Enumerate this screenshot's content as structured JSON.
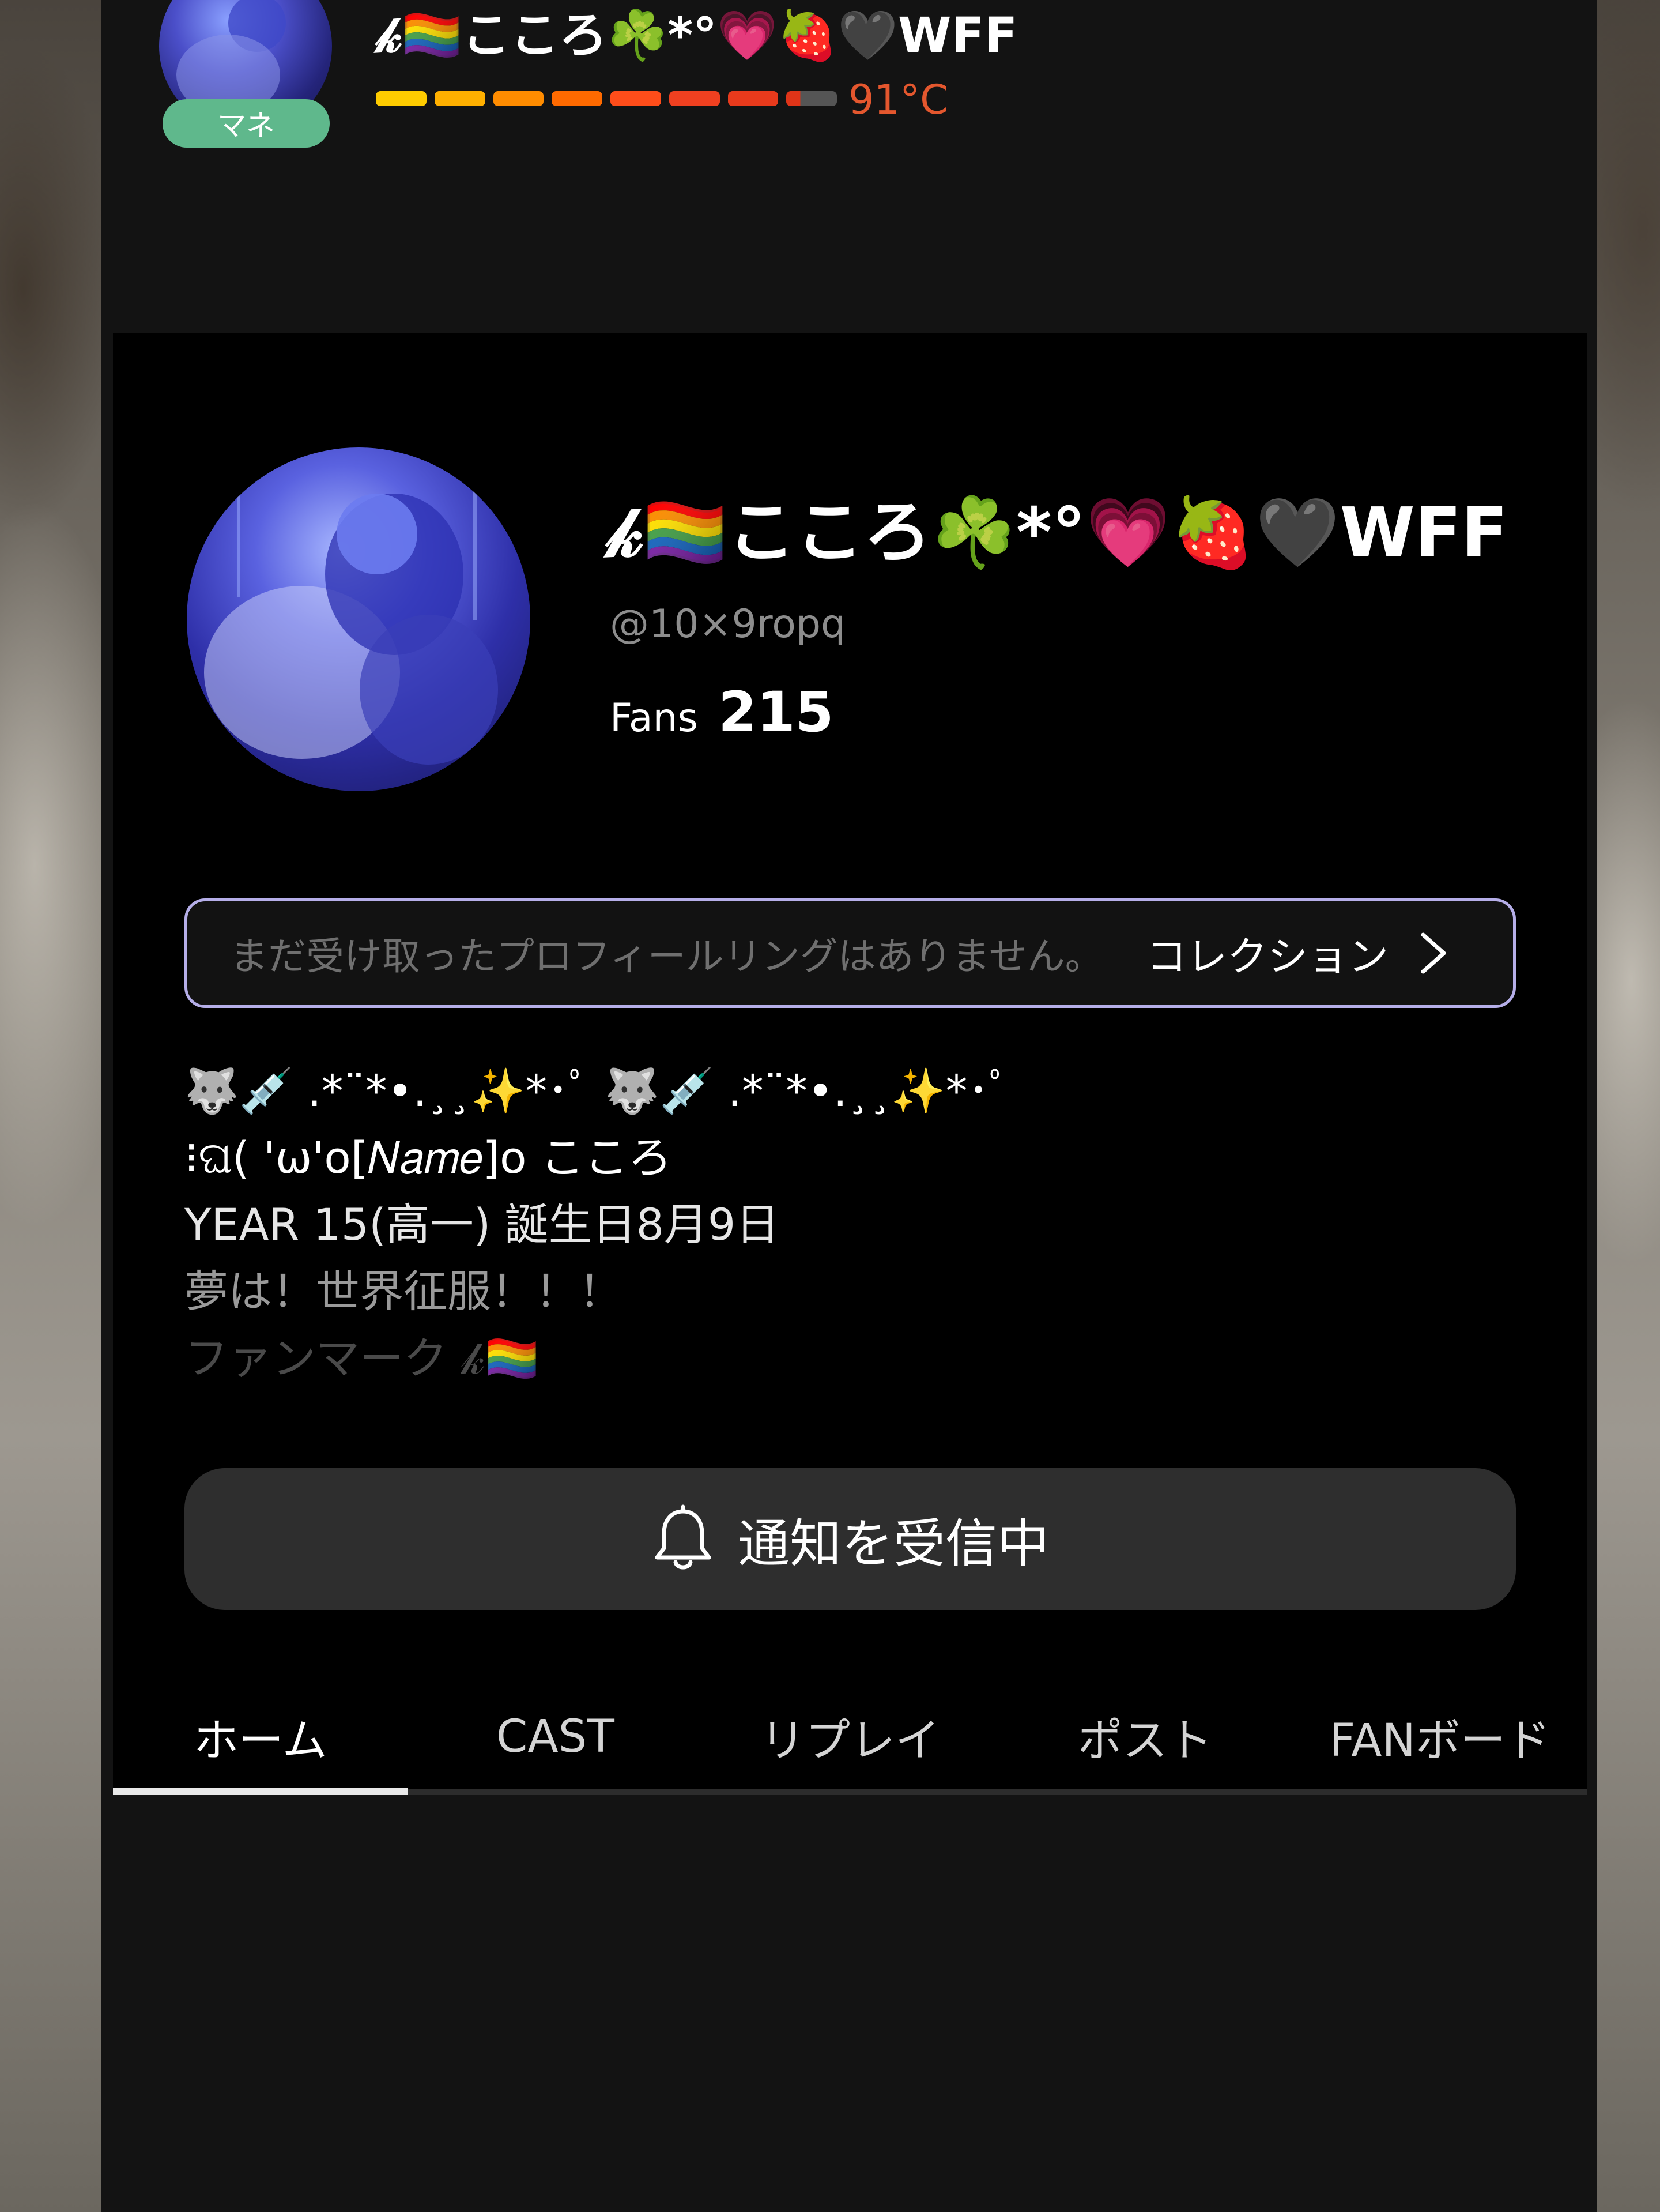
{
  "mini_header": {
    "badge": "マネ",
    "name": "𝓀🏳️‍🌈こころ☘️*°💗🍓🖤WFF",
    "temperature": "91°C",
    "heat_level_percent": 91
  },
  "profile": {
    "display_name": "𝓀🏳️‍🌈こころ☘️*°💗🍓🖤WFF",
    "handle": "@10×9ropq",
    "fans_label": "Fans",
    "fans_count": "215"
  },
  "profile_ring": {
    "empty_text": "まだ受け取ったプロフィールリングはありません。",
    "collection_label": "コレクション"
  },
  "bio": [
    "🐺💉 .*¨*•.¸¸✨*･ﾟ 🐺💉 .*¨*•.¸¸✨*･ﾟ",
    "⁝ଘ( 'ω'o[𝑁𝑎𝑚𝑒]o こころ",
    "YEAR  15(高一) 誕生日8月9日",
    "夢は！世界征服！！！",
    "ファンマーク 𝓀🏳️‍🌈"
  ],
  "notify_button": {
    "label": "通知を受信中",
    "icon": "bell-icon"
  },
  "tabs": [
    {
      "label": "ホーム",
      "active": true
    },
    {
      "label": "CAST",
      "active": false
    },
    {
      "label": "リプレイ",
      "active": false
    },
    {
      "label": "ポスト",
      "active": false
    },
    {
      "label": "FANボード",
      "active": false
    }
  ],
  "colors": {
    "panel_bg": "#131313",
    "card_bg": "#000000",
    "badge": "#5fb88c",
    "temperature": "#e4572e",
    "ring_border": "#b5aee8",
    "button_bg": "#2e2e2e"
  }
}
